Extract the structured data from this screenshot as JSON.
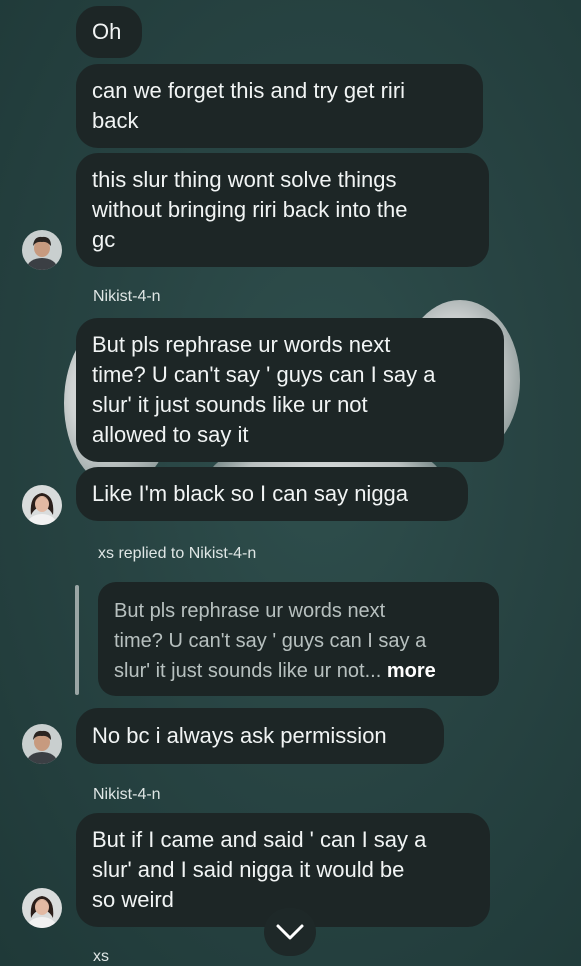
{
  "messages": [
    {
      "lines": [
        "Oh"
      ]
    },
    {
      "lines": [
        "can we forget this and try get riri",
        "back"
      ]
    },
    {
      "lines": [
        "this slur thing wont solve things",
        "without bringing riri back into the",
        "gc"
      ]
    },
    {
      "sender": "Nikist-4-n",
      "lines": [
        "But pls rephrase ur words next",
        "time? U can't say ' guys can I say a",
        "slur' it just sounds like ur not",
        "allowed to say it"
      ]
    },
    {
      "lines": [
        "Like I'm black so I can say nigga"
      ]
    },
    {
      "reply_header": "xs replied to Nikist-4-n",
      "quote_lines": [
        "But pls rephrase ur words next",
        "time? U can't say ' guys can I say a",
        "slur' it just sounds like ur not..."
      ],
      "quote_more": "more",
      "lines": [
        "No bc i always ask permission"
      ]
    },
    {
      "sender": "Nikist-4-n",
      "lines": [
        "But if I came and said ' can I say a",
        "slur' and I said nigga it would be",
        "so weird"
      ]
    },
    {
      "sender": "xs"
    }
  ],
  "icons": {
    "avatar_a": "user-avatar-photo",
    "avatar_b": "user-avatar-photo",
    "scroll": "chevron-down-icon"
  },
  "colors": {
    "background": "#284443",
    "bubble": "#1d2626",
    "text": "#f1f4f4"
  }
}
